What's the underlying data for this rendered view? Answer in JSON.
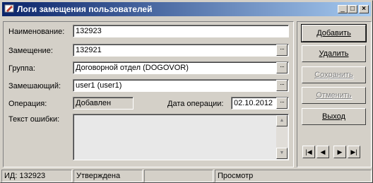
{
  "window": {
    "title": "Логи замещения пользователей",
    "minimize": "_",
    "maximize": "□",
    "close": "×"
  },
  "form": {
    "name_label": "Наименование:",
    "name_value": "132923",
    "substitution_label": "Замещение:",
    "substitution_value": "132921",
    "group_label": "Группа:",
    "group_value": "Договорной отдел (DOGOVOR)",
    "substitute_label": "Замешающий:",
    "substitute_value": "user1 (user1)",
    "operation_label": "Операция:",
    "operation_value": "Добавлен",
    "operation_date_label": "Дата операции:",
    "operation_date_value": "02.10.2012",
    "error_text_label": "Текст ошибки:",
    "error_text_value": "",
    "ellipsis": "···"
  },
  "buttons": {
    "add": "Добавить",
    "delete": "Удалить",
    "save": "Сохранить",
    "cancel": "Отменить",
    "exit": "Выход"
  },
  "nav": {
    "first": "|◀",
    "prev": "◀",
    "next": "▶",
    "last": "▶|"
  },
  "status": {
    "id": "ИД: 132923",
    "state": "Утверждена",
    "empty": "",
    "mode": "Просмотр"
  }
}
